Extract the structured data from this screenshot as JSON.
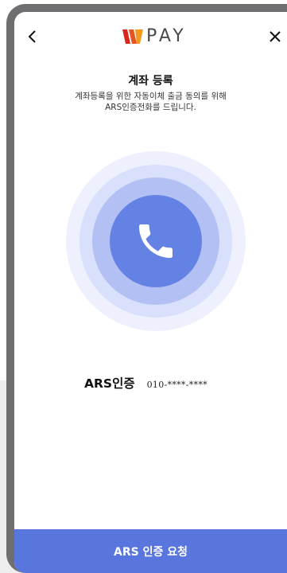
{
  "header": {
    "back_icon": "chevron-left-icon",
    "logo_text": "PAY",
    "close_icon": "close-icon"
  },
  "content": {
    "title": "계좌 등록",
    "description_lines": [
      "계좌등록을 위한 자동이체 출금 동의를 위해",
      "ARS인증전화를 드립니다."
    ],
    "phone_icon": "phone-icon"
  },
  "ars": {
    "label": "ARS인증",
    "phone_number": "010-****-****"
  },
  "cta": {
    "label": "ARS 인증 요청"
  },
  "colors": {
    "accent": "#5976de",
    "circle_core": "#6482e4",
    "frame": "#6f6f71",
    "logo_red": "#d9261c",
    "logo_orange": "#f39a1e"
  }
}
